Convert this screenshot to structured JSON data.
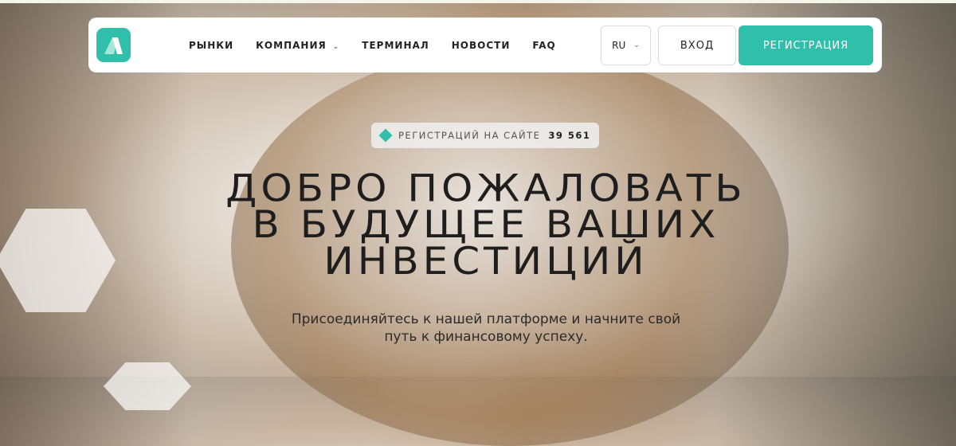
{
  "nav": {
    "items": [
      "РЫНКИ",
      "КОМПАНИЯ",
      "ТЕРМИНАЛ",
      "НОВОСТИ",
      "FAQ"
    ],
    "lang": "RU",
    "login": "ВХОД",
    "register": "РЕГИСТРАЦИЯ"
  },
  "badge": {
    "label": "РЕГИСТРАЦИЙ НА САЙТЕ",
    "count": "39 561"
  },
  "hero": {
    "title_lines": [
      "ДОБРО ПОЖАЛОВАТЬ",
      "В БУДУЩЕЕ ВАШИХ",
      "ИНВЕСТИЦИЙ"
    ],
    "subtitle_lines": [
      "Присоединяйтесь к нашей платформе и начните свой",
      "путь к финансовому успеху."
    ]
  },
  "colors": {
    "accent": "#2fbfaa"
  }
}
